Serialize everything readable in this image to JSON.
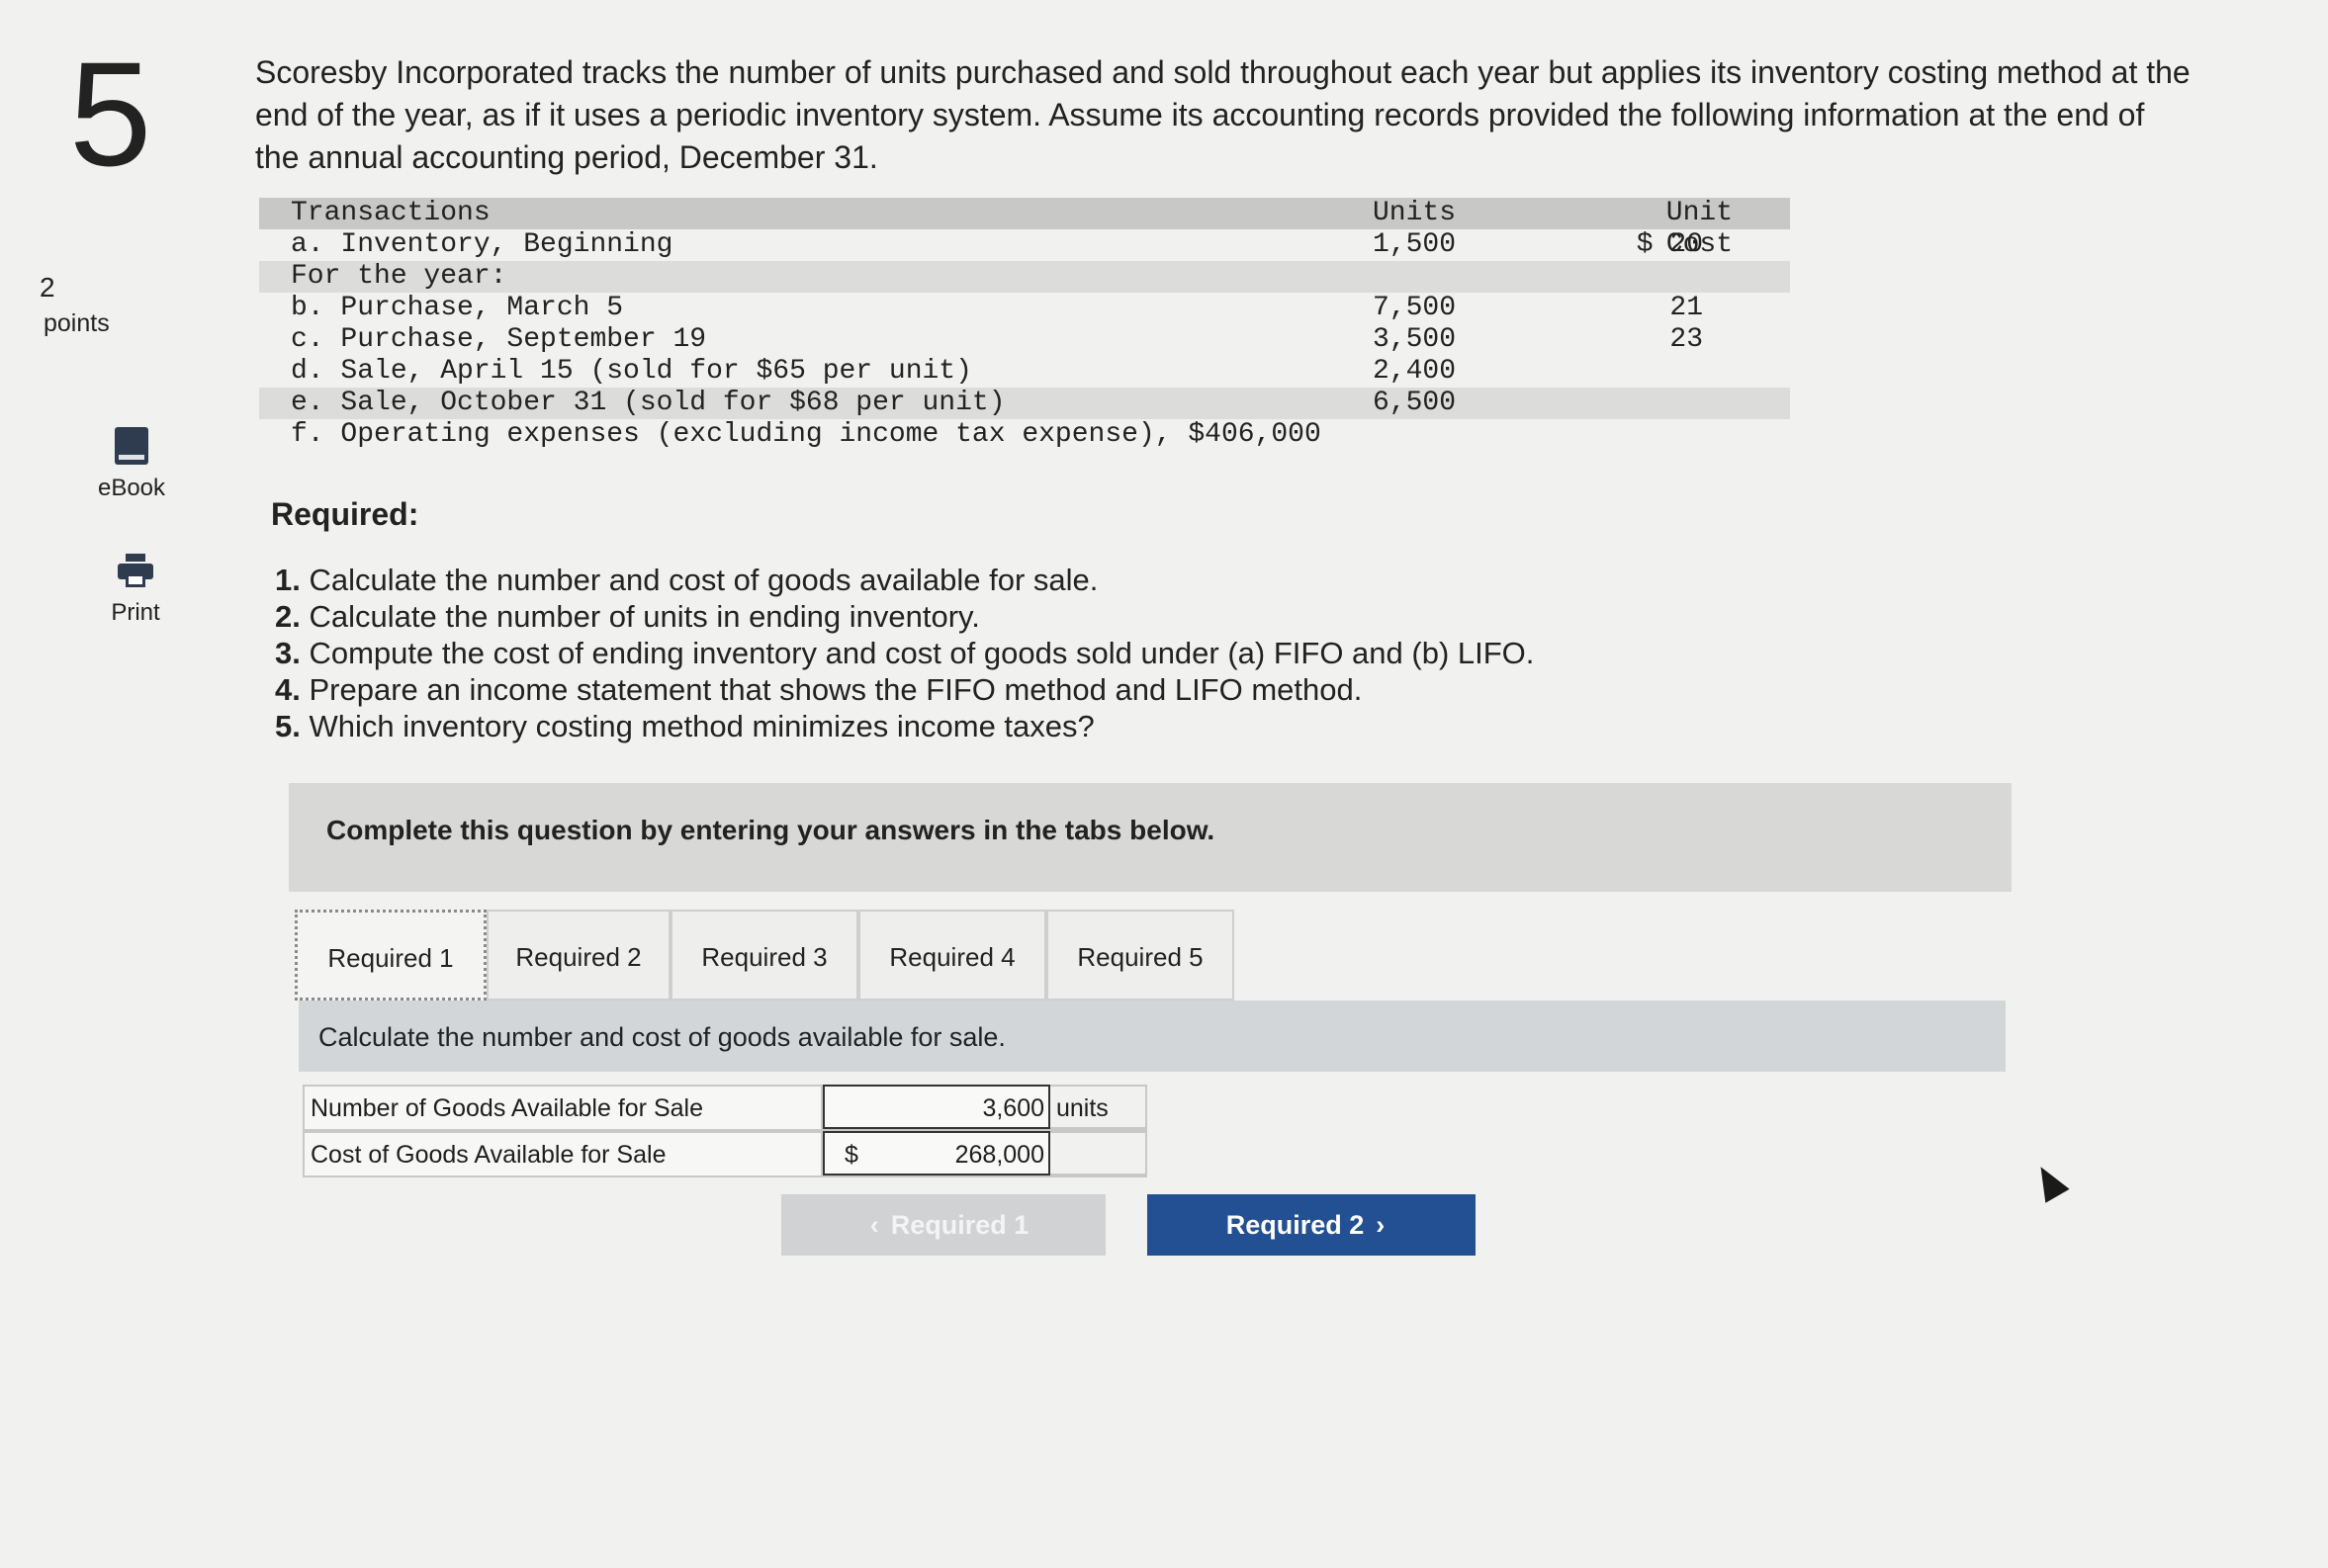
{
  "question": {
    "number": "5",
    "points_value": "2",
    "points_label": "points"
  },
  "rail": {
    "ebook_label": "eBook",
    "print_label": "Print"
  },
  "intro_text": "Scoresby Incorporated tracks the number of units purchased and sold throughout each year but applies its inventory costing method at the end of the year, as if it uses a periodic inventory system. Assume its accounting records provided the following information at the end of the annual accounting period, December 31.",
  "transactions": {
    "header": {
      "label": "Transactions",
      "units": "Units",
      "unit_cost": "Unit Cost"
    },
    "rows": [
      {
        "desc": "a. Inventory, Beginning",
        "units": "1,500",
        "cost": "$ 20"
      },
      {
        "desc": "For the year:",
        "units": "",
        "cost": ""
      },
      {
        "desc": "b. Purchase, March 5",
        "units": "7,500",
        "cost": "21"
      },
      {
        "desc": "c. Purchase, September 19",
        "units": "3,500",
        "cost": "23"
      },
      {
        "desc": "d. Sale, April 15 (sold for $65 per unit)",
        "units": "2,400",
        "cost": ""
      },
      {
        "desc": "e. Sale, October 31 (sold for $68 per unit)",
        "units": "6,500",
        "cost": ""
      },
      {
        "desc": "f. Operating expenses (excluding income tax expense), $406,000",
        "units": "",
        "cost": ""
      }
    ]
  },
  "required": {
    "title": "Required:",
    "items": [
      {
        "num": "1.",
        "text": "Calculate the number and cost of goods available for sale."
      },
      {
        "num": "2.",
        "text": "Calculate the number of units in ending inventory."
      },
      {
        "num": "3.",
        "text": "Compute the cost of ending inventory and cost of goods sold under (a) FIFO and (b) LIFO."
      },
      {
        "num": "4.",
        "text": "Prepare an income statement that shows the FIFO method and LIFO method."
      },
      {
        "num": "5.",
        "text": "Which inventory costing method minimizes income taxes?"
      }
    ]
  },
  "complete_text": "Complete this question by entering your answers in the tabs below.",
  "tabs": [
    "Required 1",
    "Required 2",
    "Required 3",
    "Required 4",
    "Required 5"
  ],
  "active_tab": "Required 1",
  "instruction": "Calculate the number and cost of goods available for sale.",
  "answers": [
    {
      "label": "Number of Goods Available for Sale",
      "currency": "",
      "value": "3,600",
      "unit": "units"
    },
    {
      "label": "Cost of Goods Available for Sale",
      "currency": "$",
      "value": "268,000",
      "unit": ""
    }
  ],
  "nav": {
    "prev_label": "Required 1",
    "next_label": "Required 2"
  }
}
